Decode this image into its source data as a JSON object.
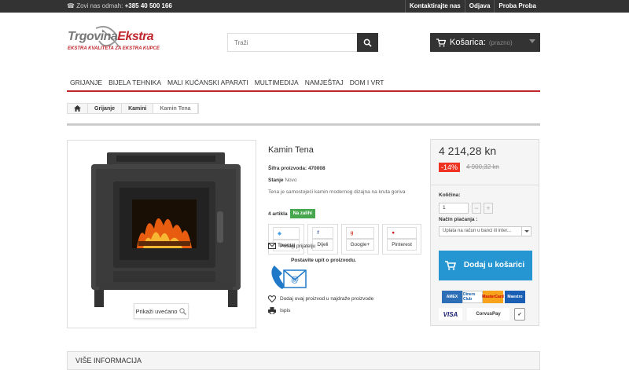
{
  "topbar": {
    "phone_label": "Zovi nas odmah:",
    "phone_number": "+385 40 500 166",
    "links": [
      "Kontaktirajte nas",
      "Odjava",
      "Proba Proba"
    ]
  },
  "logo": {
    "line1_a": "Trgovina",
    "line1_b": "Ekstra",
    "line2": "EKSTRA KVALITETA ZA EKSTRA KUPCE"
  },
  "search": {
    "placeholder": "Traži"
  },
  "cart": {
    "label": "Košarica:",
    "status": "(prazno)"
  },
  "menu": [
    "GRIJANJE",
    "BIJELA TEHNIKA",
    "MALI KUĆANSKI APARATI",
    "MULTIMEDIJA",
    "NAMJEŠTAJ",
    "DOM I VRT"
  ],
  "breadcrumb": [
    "Grijanje",
    "Kamini",
    "Kamin Tena"
  ],
  "product": {
    "zoom_label": "Prikaži uvećano",
    "title": "Kamin Tena",
    "sku_label": "Šifra proizvoda:",
    "sku": "470008",
    "condition_label": "Stanje",
    "condition": "Novo",
    "description": "Tena je samostojeći kamin modernog dizajna na kruta goriva",
    "stock_count": "4 artikla",
    "stock_badge": "Na zalihi",
    "shares": [
      "Tweetaj",
      "Dijeli",
      "Google+",
      "Pinterest"
    ],
    "send_friend": "Pošalji prijatelju",
    "inquiry": "Postavite upit o proizvodu.",
    "wishlist": "Dodaj ovaj proizvod u najdraže proizvode",
    "print": "Ispis"
  },
  "buy": {
    "price": "4 214,28 kn",
    "discount": "-14%",
    "old_price": "4 900,32 kn",
    "qty_label": "Količina:",
    "qty_value": "1",
    "payment_label": "Način plaćanja :",
    "payment_value": "Uplata na račun u banci ili inter...",
    "add_to_cart": "Dodaj u košarici",
    "cards": [
      "AMEX",
      "Diners Club",
      "MasterCard",
      "Maestro",
      "VISA",
      "CorvusPay"
    ]
  },
  "more_info": {
    "title": "VIŠE INFORMACIJA"
  },
  "colors": {
    "accent": "#c0272d",
    "button_blue": "#2596d1",
    "in_stock": "#46a74e",
    "discount": "#ee3322",
    "dark": "#333333"
  }
}
